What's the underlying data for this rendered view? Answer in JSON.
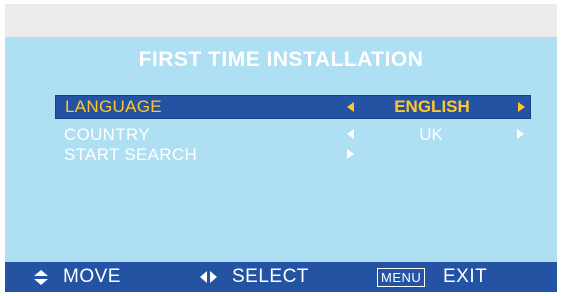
{
  "header": {
    "title": "FIRST TIME INSTALLATION"
  },
  "menu": {
    "items": [
      {
        "label": "LANGUAGE",
        "value": "ENGLISH"
      },
      {
        "label": "COUNTRY",
        "value": "UK"
      },
      {
        "label": "START SEARCH",
        "value": ""
      }
    ]
  },
  "footer": {
    "move_label": "MOVE",
    "select_label": "SELECT",
    "menu_key_label": "MENU",
    "exit_label": "EXIT"
  },
  "colors": {
    "screen_background": "#aedff3",
    "bar_background": "#2553a3",
    "highlight_text": "#ffc72a",
    "text": "#ffffff"
  }
}
